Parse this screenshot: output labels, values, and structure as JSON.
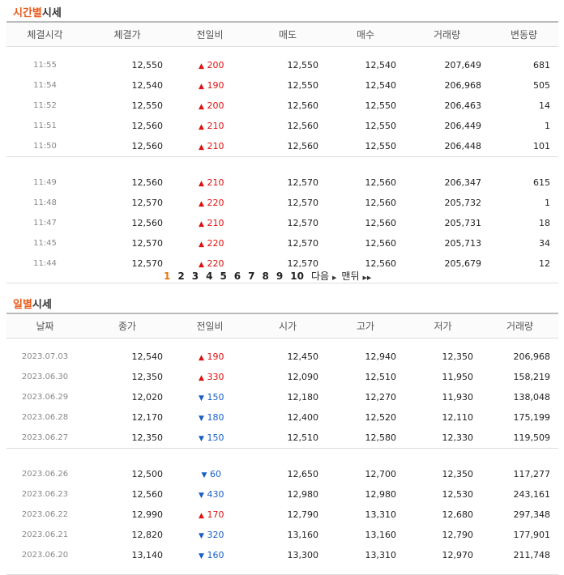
{
  "time_section": {
    "title_accent": "시간별",
    "title_rest": "시세",
    "headers": [
      "체결시각",
      "체결가",
      "전일비",
      "매도",
      "매수",
      "거래량",
      "변동량"
    ],
    "groups": [
      [
        {
          "time": "11:55",
          "price": "12,550",
          "dir": "up",
          "diff": "200",
          "sell": "12,550",
          "buy": "12,540",
          "volume": "207,649",
          "change": "681"
        },
        {
          "time": "11:54",
          "price": "12,540",
          "dir": "up",
          "diff": "190",
          "sell": "12,550",
          "buy": "12,540",
          "volume": "206,968",
          "change": "505"
        },
        {
          "time": "11:52",
          "price": "12,550",
          "dir": "up",
          "diff": "200",
          "sell": "12,560",
          "buy": "12,550",
          "volume": "206,463",
          "change": "14"
        },
        {
          "time": "11:51",
          "price": "12,560",
          "dir": "up",
          "diff": "210",
          "sell": "12,560",
          "buy": "12,550",
          "volume": "206,449",
          "change": "1"
        },
        {
          "time": "11:50",
          "price": "12,560",
          "dir": "up",
          "diff": "210",
          "sell": "12,560",
          "buy": "12,550",
          "volume": "206,448",
          "change": "101"
        }
      ],
      [
        {
          "time": "11:49",
          "price": "12,560",
          "dir": "up",
          "diff": "210",
          "sell": "12,570",
          "buy": "12,560",
          "volume": "206,347",
          "change": "615"
        },
        {
          "time": "11:48",
          "price": "12,570",
          "dir": "up",
          "diff": "220",
          "sell": "12,570",
          "buy": "12,560",
          "volume": "205,732",
          "change": "1"
        },
        {
          "time": "11:47",
          "price": "12,560",
          "dir": "up",
          "diff": "210",
          "sell": "12,570",
          "buy": "12,560",
          "volume": "205,731",
          "change": "18"
        },
        {
          "time": "11:45",
          "price": "12,570",
          "dir": "up",
          "diff": "220",
          "sell": "12,570",
          "buy": "12,560",
          "volume": "205,713",
          "change": "34"
        },
        {
          "time": "11:44",
          "price": "12,570",
          "dir": "up",
          "diff": "220",
          "sell": "12,570",
          "buy": "12,560",
          "volume": "205,679",
          "change": "12"
        }
      ]
    ]
  },
  "pager": {
    "pages": [
      "1",
      "2",
      "3",
      "4",
      "5",
      "6",
      "7",
      "8",
      "9",
      "10"
    ],
    "current": "1",
    "next_label": "다음",
    "last_label": "맨뒤"
  },
  "daily_section": {
    "title_accent": "일별",
    "title_rest": "시세",
    "headers": [
      "날짜",
      "종가",
      "전일비",
      "시가",
      "고가",
      "저가",
      "거래량"
    ],
    "groups": [
      [
        {
          "date": "2023.07.03",
          "close": "12,540",
          "dir": "up",
          "diff": "190",
          "open": "12,450",
          "high": "12,940",
          "low": "12,350",
          "volume": "206,968"
        },
        {
          "date": "2023.06.30",
          "close": "12,350",
          "dir": "up",
          "diff": "330",
          "open": "12,090",
          "high": "12,510",
          "low": "11,950",
          "volume": "158,219"
        },
        {
          "date": "2023.06.29",
          "close": "12,020",
          "dir": "down",
          "diff": "150",
          "open": "12,180",
          "high": "12,270",
          "low": "11,930",
          "volume": "138,048"
        },
        {
          "date": "2023.06.28",
          "close": "12,170",
          "dir": "down",
          "diff": "180",
          "open": "12,400",
          "high": "12,520",
          "low": "12,110",
          "volume": "175,199"
        },
        {
          "date": "2023.06.27",
          "close": "12,350",
          "dir": "down",
          "diff": "150",
          "open": "12,510",
          "high": "12,580",
          "low": "12,330",
          "volume": "119,509"
        }
      ],
      [
        {
          "date": "2023.06.26",
          "close": "12,500",
          "dir": "down",
          "diff": "60",
          "open": "12,650",
          "high": "12,700",
          "low": "12,350",
          "volume": "117,277"
        },
        {
          "date": "2023.06.23",
          "close": "12,560",
          "dir": "down",
          "diff": "430",
          "open": "12,980",
          "high": "12,980",
          "low": "12,530",
          "volume": "243,161"
        },
        {
          "date": "2023.06.22",
          "close": "12,990",
          "dir": "up",
          "diff": "170",
          "open": "12,790",
          "high": "13,310",
          "low": "12,680",
          "volume": "297,348"
        },
        {
          "date": "2023.06.21",
          "close": "12,820",
          "dir": "down",
          "diff": "320",
          "open": "13,160",
          "high": "13,160",
          "low": "12,790",
          "volume": "177,901"
        },
        {
          "date": "2023.06.20",
          "close": "13,140",
          "dir": "down",
          "diff": "160",
          "open": "13,300",
          "high": "13,310",
          "low": "12,970",
          "volume": "211,748"
        }
      ]
    ]
  },
  "colors": {
    "accent": "#e85a1a",
    "up": "#dd1111",
    "down": "#1a5fc6"
  }
}
